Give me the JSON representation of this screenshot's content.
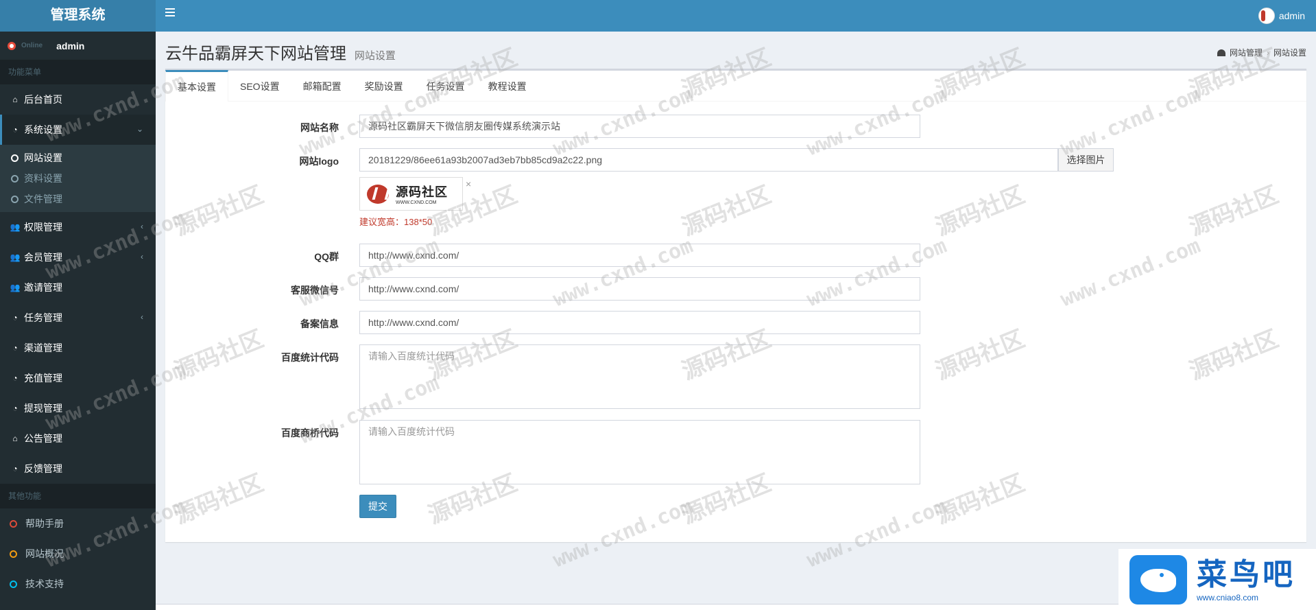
{
  "header": {
    "app_title": "管理系统",
    "username": "admin"
  },
  "sidebar": {
    "username": "admin",
    "user_status": "Online",
    "section_main": "功能菜单",
    "items": [
      {
        "label": "后台首页",
        "icon": "home-icon"
      },
      {
        "label": "系统设置",
        "icon": "dashboard-icon",
        "open": true
      },
      {
        "label": "权限管理",
        "icon": "users-icon"
      },
      {
        "label": "会员管理",
        "icon": "users-icon"
      },
      {
        "label": "邀请管理",
        "icon": "users-icon"
      },
      {
        "label": "任务管理",
        "icon": "dashboard-icon"
      },
      {
        "label": "渠道管理",
        "icon": "dashboard-icon"
      },
      {
        "label": "充值管理",
        "icon": "dashboard-icon"
      },
      {
        "label": "提现管理",
        "icon": "dashboard-icon"
      },
      {
        "label": "公告管理",
        "icon": "home-icon"
      },
      {
        "label": "反馈管理",
        "icon": "dashboard-icon"
      }
    ],
    "submenu": [
      {
        "label": "网站设置",
        "active": true
      },
      {
        "label": "资料设置"
      },
      {
        "label": "文件管理"
      }
    ],
    "section_other": "其他功能",
    "other_items": [
      {
        "label": "帮助手册",
        "color": "#dd4b39"
      },
      {
        "label": "网站概况",
        "color": "#f39c12"
      },
      {
        "label": "技术支持",
        "color": "#00c0ef"
      }
    ]
  },
  "content": {
    "title": "云牛品霸屏天下网站管理",
    "subtitle": "网站设置",
    "breadcrumb": [
      "网站管理",
      "网站设置"
    ]
  },
  "tabs": [
    "基本设置",
    "SEO设置",
    "邮箱配置",
    "奖励设置",
    "任务设置",
    "教程设置"
  ],
  "form": {
    "site_name_label": "网站名称",
    "site_name_value": "源码社区霸屏天下微信朋友圈传媒系统演示站",
    "logo_label": "网站logo",
    "logo_value": "20181229/86ee61a93b2007ad3eb7bb85cd9a2c22.png",
    "logo_button": "选择图片",
    "logo_preview_text": "源码社区",
    "logo_preview_url": "WWW.CXND.COM",
    "logo_remove": "×",
    "logo_hint": "建议宽高：138*50",
    "qq_label": "QQ群",
    "qq_value": "http://www.cxnd.com/",
    "wechat_label": "客服微信号",
    "wechat_value": "http://www.cxnd.com/",
    "icp_label": "备案信息",
    "icp_value": "http://www.cxnd.com/",
    "baidu_stat_label": "百度统计代码",
    "baidu_stat_placeholder": "请输入百度统计代码",
    "baidu_bridge_label": "百度商桥代码",
    "baidu_bridge_placeholder": "请输入百度统计代码",
    "submit_label": "提交"
  },
  "watermark": {
    "url": "www.cxnd.com",
    "cn": "源码社区"
  },
  "brand": {
    "name": "菜鸟吧",
    "url": "www.cniao8.com"
  },
  "colors": {
    "primary": "#3c8dbc",
    "sidebar_bg": "#222d32",
    "hint": "#c0392b"
  }
}
